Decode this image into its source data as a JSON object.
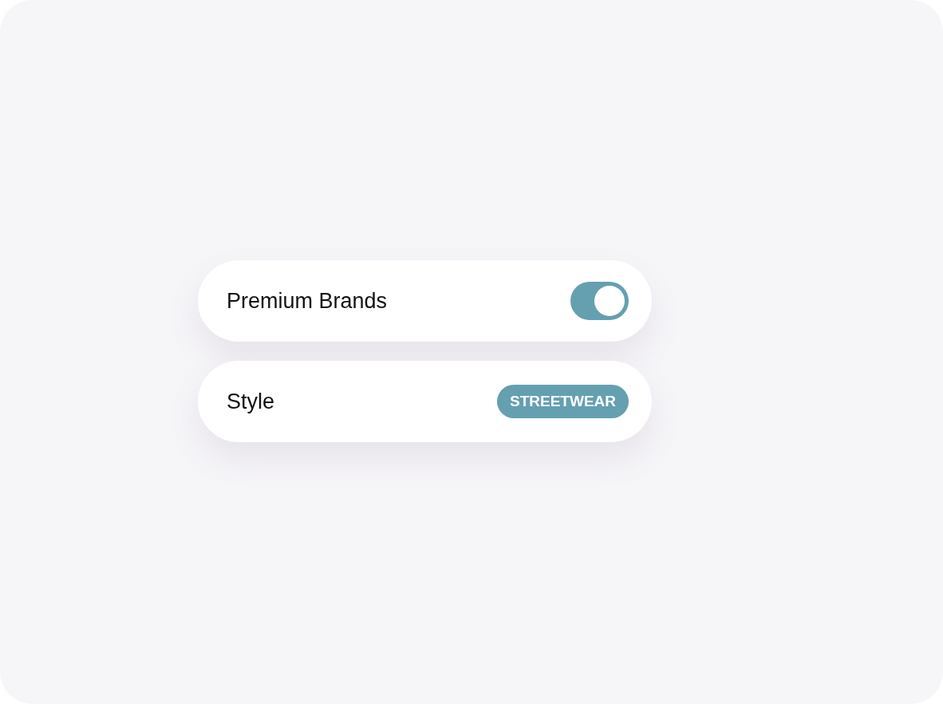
{
  "settings": [
    {
      "kind": "toggle",
      "label": "Premium Brands",
      "on": true
    },
    {
      "kind": "chip",
      "label": "Style",
      "value": "STREETWEAR"
    }
  ]
}
